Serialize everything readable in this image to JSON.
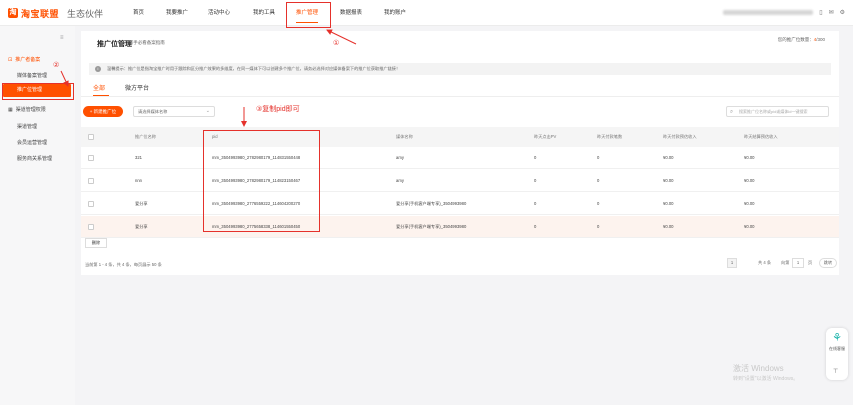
{
  "header": {
    "logo_text": "淘宝联盟",
    "logo_sub": "生态伙伴",
    "nav": [
      "首页",
      "我要推广",
      "活动中心",
      "我的工具",
      "推广管理",
      "数据报表",
      "我的账户"
    ]
  },
  "sidebar": {
    "group1": "推广者备案",
    "group1_items": [
      "媒体备案管理",
      "推广位管理"
    ],
    "group2": "渠道管理权限",
    "group2_items": [
      "渠道管理",
      "会员运营管理",
      "服务商关系管理"
    ]
  },
  "main": {
    "title": "推广位管理",
    "help_link": "新手必看备案指南",
    "quota_label": "您的推广位数量：",
    "quota_value": "4",
    "quota_total": "/300",
    "notice": "温馨提示：推广位是指淘宝推广时用于跟踪和区分推广效果的多维度，在同一媒体下可以创建多个推广位，请务必选择对应媒体备案下的推广位获取推广链接！",
    "tabs": [
      "全部",
      "微方平台"
    ],
    "new_button": "+ 新建推广位",
    "select_placeholder": "请选择媒体名称",
    "search_placeholder": "搜索推广位名称或pid或媒体id一键搜索",
    "columns": [
      "推广位名称",
      "pid",
      "媒体名称",
      "昨天点击PV",
      "昨天付款笔数",
      "昨天付款预估收入",
      "昨天结算预估收入"
    ],
    "rows": [
      {
        "name": "321",
        "pid": "mm_3504993980_2782980179_114831550448",
        "media": "amy",
        "pv": "0",
        "orders": "0",
        "est_income": "¥0.00",
        "settle_income": "¥0.00"
      },
      {
        "name": "nnn",
        "pid": "mm_3504993980_2782980179_114823150467",
        "media": "amy",
        "pv": "0",
        "orders": "0",
        "est_income": "¥0.00",
        "settle_income": "¥0.00"
      },
      {
        "name": "爱分享",
        "pid": "mm_3504993980_2776559222_114604200270",
        "media": "爱分享(手机客户端专享)_3504993980",
        "pv": "0",
        "orders": "0",
        "est_income": "¥0.00",
        "settle_income": "¥0.00"
      },
      {
        "name": "爱分享",
        "pid": "mm_3504993980_2775658338_114601550450",
        "media": "爱分享(手机客户端专享)_3504993980",
        "pv": "0",
        "orders": "0",
        "est_income": "¥0.00",
        "settle_income": "¥0.00"
      }
    ],
    "delete_button": "删除",
    "summary": "当前第 1 - 4 条，共 4 条，每页展示 50 条",
    "pager": {
      "current": "1",
      "total_label": "共 4 条",
      "goto_label": "向第",
      "goto_value": "1",
      "page_label": "页",
      "go_button": "跳转"
    }
  },
  "annotations": {
    "step1": "①",
    "step2": "②",
    "step3": "③复制pid即可"
  },
  "float_help": {
    "label": "在线客服"
  },
  "watermark": {
    "line1": "激活 Windows",
    "line2": "转到\"设置\"以激活 Windows。"
  },
  "colors": {
    "accent": "#ff5000",
    "annotation": "#e5312b",
    "highlight_row": "#fdf3ee"
  }
}
